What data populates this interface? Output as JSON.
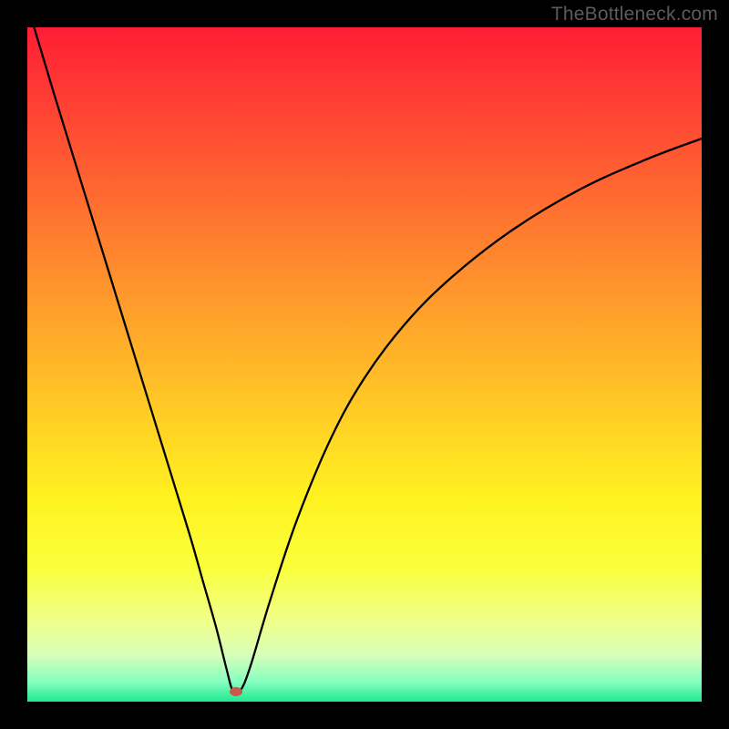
{
  "watermark": "TheBottleneck.com",
  "chart_data": {
    "type": "line",
    "title": "",
    "xlabel": "",
    "ylabel": "",
    "xlim": [
      0,
      100
    ],
    "ylim": [
      0,
      100
    ],
    "grid": false,
    "legend": false,
    "series": [
      {
        "name": "bottleneck-curve",
        "x": [
          1,
          4,
          8,
          12,
          16,
          20,
          24,
          26,
          28,
          29.5,
          30.5,
          31.5,
          33,
          36,
          40,
          45,
          50,
          56,
          63,
          72,
          82,
          92,
          100
        ],
        "y": [
          100,
          90,
          77,
          64,
          51,
          38,
          25,
          18,
          11,
          5,
          1.5,
          1.5,
          5,
          15,
          27,
          39,
          48,
          56,
          63,
          70,
          76,
          80.5,
          83.5
        ]
      }
    ],
    "annotations": [
      {
        "type": "point",
        "name": "marker-dot",
        "x": 31.0,
        "y": 1.5,
        "color": "#c55a4a"
      }
    ],
    "colors": {
      "curve": "#000000",
      "gradient_top": "#ff1d35",
      "gradient_bottom": "#20e890"
    }
  }
}
